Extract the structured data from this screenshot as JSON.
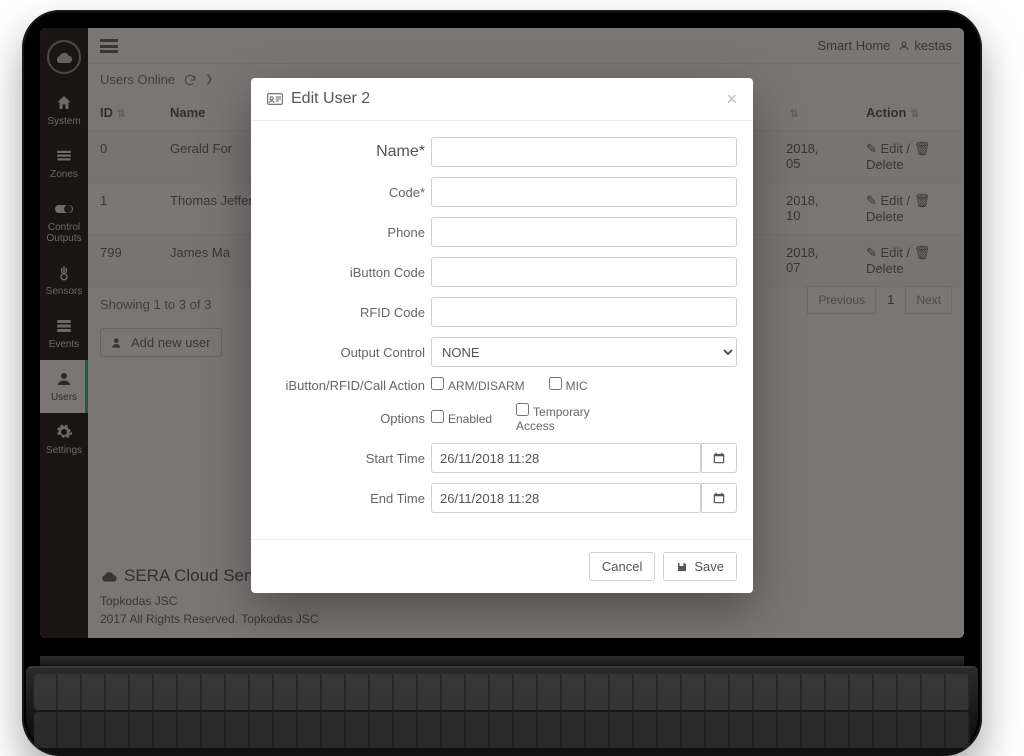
{
  "topbar": {
    "site_name": "Smart Home",
    "username": "kestas"
  },
  "sidebar": {
    "items": [
      {
        "key": "system",
        "label": "System"
      },
      {
        "key": "zones",
        "label": "Zones"
      },
      {
        "key": "control-outputs",
        "label": "Control Outputs"
      },
      {
        "key": "sensors",
        "label": "Sensors"
      },
      {
        "key": "events",
        "label": "Events"
      },
      {
        "key": "users",
        "label": "Users"
      },
      {
        "key": "settings",
        "label": "Settings"
      }
    ]
  },
  "crumbs": {
    "a": "Users Online"
  },
  "table": {
    "headers": {
      "id": "ID",
      "name": "Name",
      "date": "",
      "action": "Action"
    },
    "rows": [
      {
        "id": "0",
        "name": "Gerald For",
        "date": "2018,\n05",
        "edit": "Edit",
        "delete": "Delete"
      },
      {
        "id": "1",
        "name": "Thomas Jefferson",
        "date": "2018,\n10",
        "edit": "Edit",
        "delete": "Delete"
      },
      {
        "id": "799",
        "name": "James Ma",
        "date": "2018,\n07",
        "edit": "Edit",
        "delete": "Delete"
      }
    ],
    "showing": "Showing 1 to 3 of 3",
    "add_user": "Add new user",
    "pager": {
      "prev": "Previous",
      "current": "1",
      "next": "Next"
    }
  },
  "footer": {
    "title": "SERA Cloud Service",
    "line1": "Topkodas JSC",
    "line2": "2017 All Rights Reserved. Topkodas JSC"
  },
  "modal": {
    "title": "Edit User 2",
    "labels": {
      "name": "Name*",
      "code": "Code*",
      "phone": "Phone",
      "ibutton": "iButton Code",
      "rfid": "RFID Code",
      "output": "Output Control",
      "action": "iButton/RFID/Call Action",
      "options": "Options",
      "start": "Start Time",
      "end": "End Time"
    },
    "action": {
      "arm": "ARM/DISARM",
      "mic": "MIC"
    },
    "options": {
      "enabled": "Enabled",
      "temp": "Temporary Access"
    },
    "output_selected": "NONE",
    "start_value": "26/11/2018 11:28",
    "end_value": "26/11/2018 11:28",
    "buttons": {
      "cancel": "Cancel",
      "save": "Save"
    }
  }
}
